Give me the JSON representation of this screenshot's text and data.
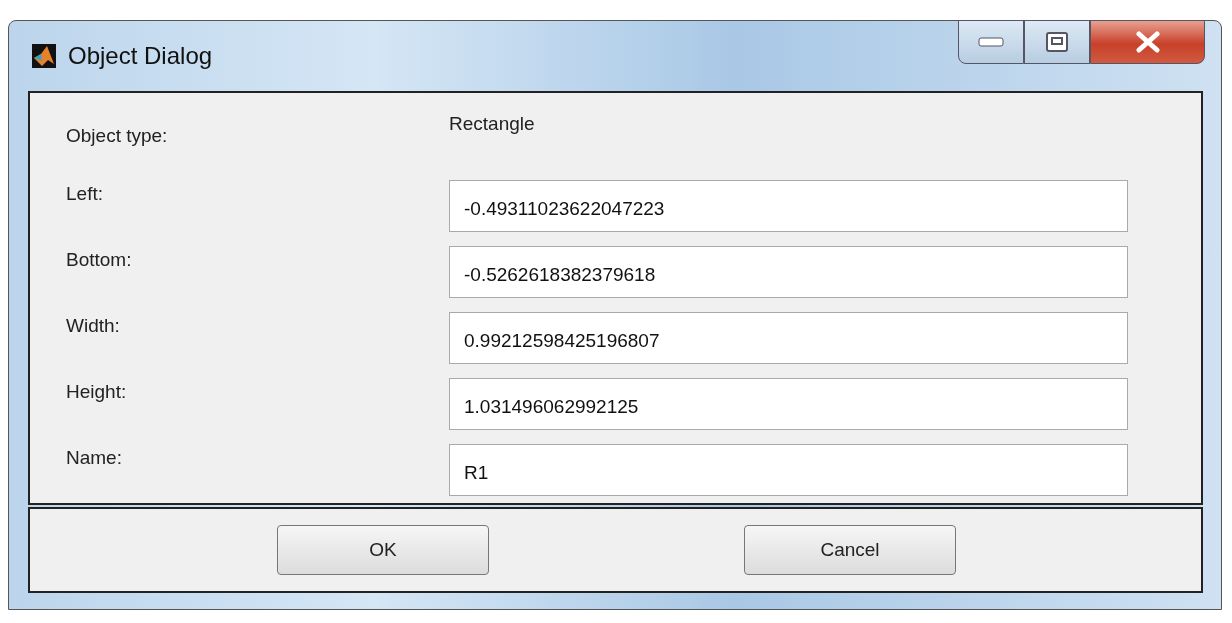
{
  "window": {
    "title": "Object Dialog"
  },
  "object_type": {
    "label": "Object type:",
    "value": "Rectangle"
  },
  "fields": [
    {
      "label": "Left:",
      "value": "-0.49311023622047223"
    },
    {
      "label": "Bottom:",
      "value": "-0.5262618382379618"
    },
    {
      "label": "Width:",
      "value": "0.99212598425196807"
    },
    {
      "label": "Height:",
      "value": "1.031496062992125"
    },
    {
      "label": "Name:",
      "value": "R1"
    }
  ],
  "buttons": [
    "OK",
    "Cancel"
  ]
}
